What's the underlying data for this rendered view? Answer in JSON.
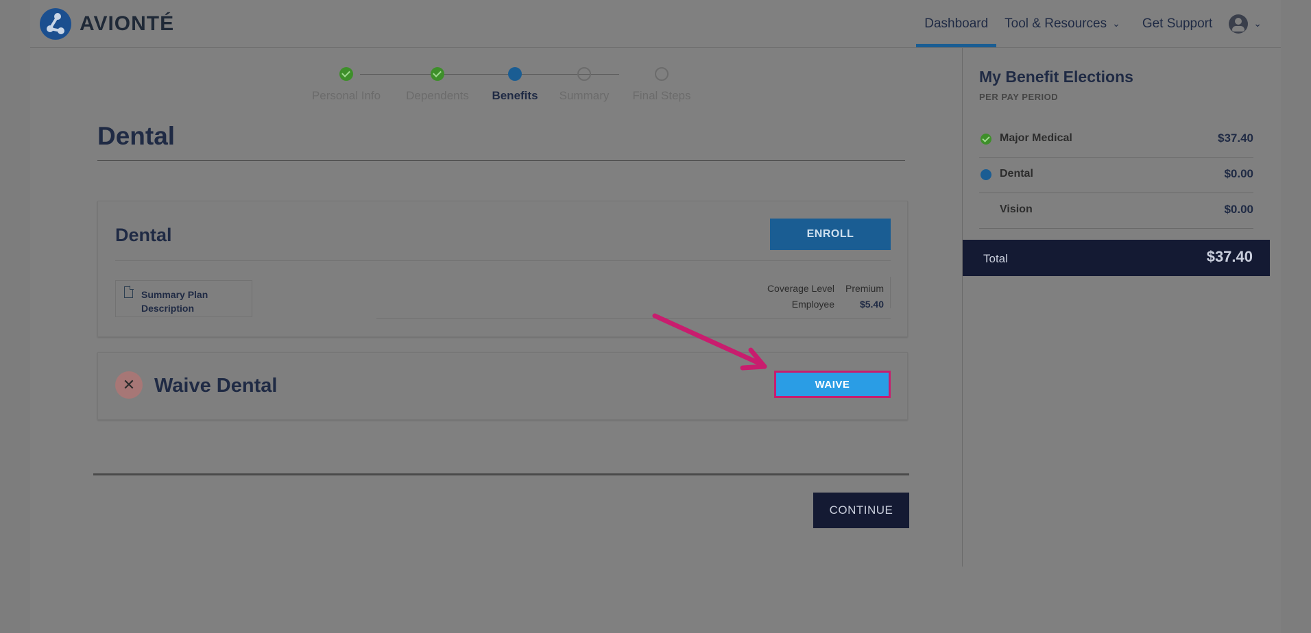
{
  "brand": {
    "name": "AVIONTÉ"
  },
  "nav": {
    "dashboard": "Dashboard",
    "tools": "Tool & Resources",
    "support": "Get Support"
  },
  "stepper": {
    "steps": [
      {
        "label": "Personal Info",
        "status": "done"
      },
      {
        "label": "Dependents",
        "status": "done"
      },
      {
        "label": "Benefits",
        "status": "current"
      },
      {
        "label": "Summary",
        "status": "todo"
      },
      {
        "label": "Final Steps",
        "status": "todo"
      }
    ]
  },
  "main": {
    "title": "Dental",
    "plan_card": {
      "title": "Dental",
      "enroll_label": "ENROLL",
      "doc_label_line1": "Summary Plan",
      "doc_label_line2": "Description",
      "coverage_header": "Coverage Level",
      "premium_header": "Premium",
      "coverage_value": "Employee",
      "premium_value": "$5.40"
    },
    "waive_card": {
      "title": "Waive Dental",
      "waive_label": "WAIVE"
    },
    "continue_label": "CONTINUE"
  },
  "sidebar": {
    "title": "My Benefit Elections",
    "subtitle": "PER PAY PERIOD",
    "items": [
      {
        "name": "Major Medical",
        "amount": "$37.40",
        "status": "done"
      },
      {
        "name": "Dental",
        "amount": "$0.00",
        "status": "current"
      },
      {
        "name": "Vision",
        "amount": "$0.00",
        "status": "none"
      }
    ],
    "total_label": "Total",
    "total_amount": "$37.40"
  },
  "colors": {
    "accent": "#1a5d93",
    "waive_button": "#2a9de5",
    "highlight": "#c81d6e",
    "navy": "#141a33",
    "success": "#3e8f2a"
  }
}
